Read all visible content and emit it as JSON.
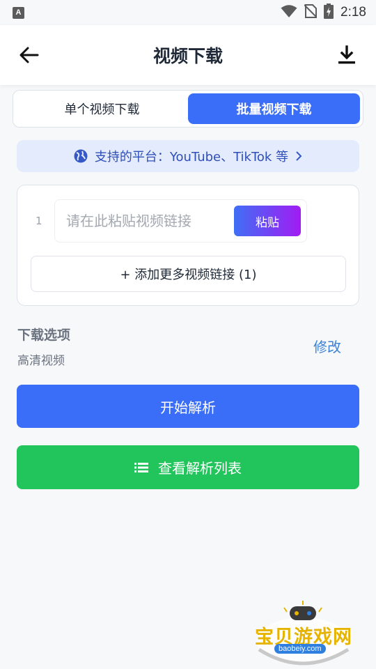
{
  "status_bar": {
    "notification_badge": "A",
    "time": "2:18",
    "icons": [
      "wifi-icon",
      "no-sim-icon",
      "battery-charging-icon"
    ]
  },
  "header": {
    "title": "视频下载",
    "back_icon": "arrow-left-icon",
    "download_icon": "download-icon"
  },
  "tabs": [
    {
      "label": "单个视频下载",
      "active": false
    },
    {
      "label": "批量视频下载",
      "active": true
    }
  ],
  "platform_banner": {
    "text": "支持的平台：YouTube、TikTok 等",
    "icon": "globe-icon",
    "chevron": "chevron-right-icon"
  },
  "link_inputs": [
    {
      "index": "1",
      "value": "",
      "placeholder": "请在此粘贴视频链接",
      "paste_label": "粘贴"
    }
  ],
  "add_more_label": "+ 添加更多视频链接 (1)",
  "download_options": {
    "title": "下载选项",
    "value": "高清视频",
    "modify_label": "修改"
  },
  "actions": {
    "start_label": "开始解析",
    "list_label": "查看解析列表",
    "list_icon": "list-icon"
  },
  "watermark": {
    "text": "宝贝游戏网",
    "domain": "baobeiy.com"
  },
  "colors": {
    "accent": "#3b6ef8",
    "green": "#22c45c",
    "banner_bg": "#e4ebfd",
    "link": "#3b82d6"
  }
}
